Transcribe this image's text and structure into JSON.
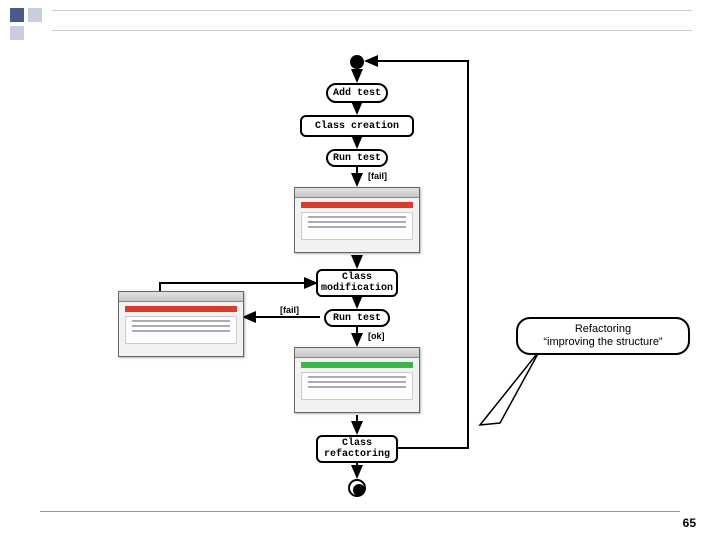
{
  "decor": {},
  "diagram": {
    "steps": {
      "add_test": "Add test",
      "class_creation": "Class creation",
      "run_test_1": "Run test",
      "class_modification": "Class\nmodification",
      "run_test_2": "Run test",
      "class_refactoring": "Class\nrefactoring"
    },
    "labels": {
      "fail_1": "[fail]",
      "fail_2": "[fail]",
      "ok": "[ok]"
    }
  },
  "callout": {
    "line1": "Refactoring",
    "line2": "“improving the structure”"
  },
  "page_number": "65"
}
